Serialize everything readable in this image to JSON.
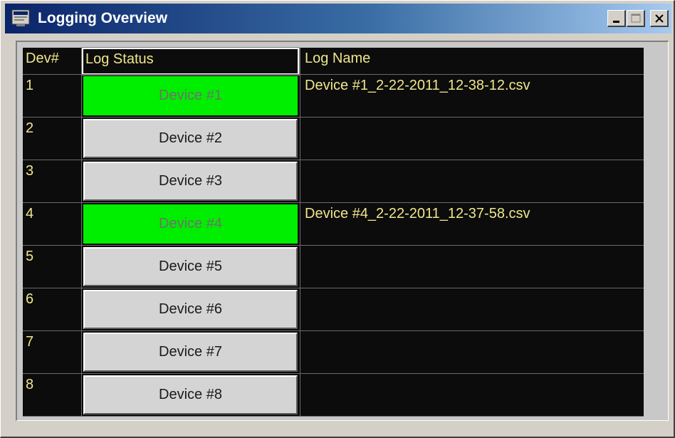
{
  "window": {
    "title": "Logging Overview"
  },
  "grid": {
    "headers": {
      "dev": "Dev#",
      "status": "Log Status",
      "name": "Log Name"
    },
    "rows": [
      {
        "dev": "1",
        "status": "Device #1",
        "active": true,
        "log_name": "Device #1_2-22-2011_12-38-12.csv"
      },
      {
        "dev": "2",
        "status": "Device #2",
        "active": false,
        "log_name": ""
      },
      {
        "dev": "3",
        "status": "Device #3",
        "active": false,
        "log_name": ""
      },
      {
        "dev": "4",
        "status": "Device #4",
        "active": true,
        "log_name": "Device #4_2-22-2011_12-37-58.csv"
      },
      {
        "dev": "5",
        "status": "Device #5",
        "active": false,
        "log_name": ""
      },
      {
        "dev": "6",
        "status": "Device #6",
        "active": false,
        "log_name": ""
      },
      {
        "dev": "7",
        "status": "Device #7",
        "active": false,
        "log_name": ""
      },
      {
        "dev": "8",
        "status": "Device #8",
        "active": false,
        "log_name": ""
      }
    ]
  },
  "colors": {
    "grid_background": "#0c0c0c",
    "grid_text": "#f0e68c",
    "active_status": "#00ee00",
    "inactive_status": "#d4d4d4"
  },
  "icons": {
    "window": "app-window-icon",
    "minimize": "minimize-icon",
    "maximize": "maximize-icon",
    "close": "close-icon"
  }
}
